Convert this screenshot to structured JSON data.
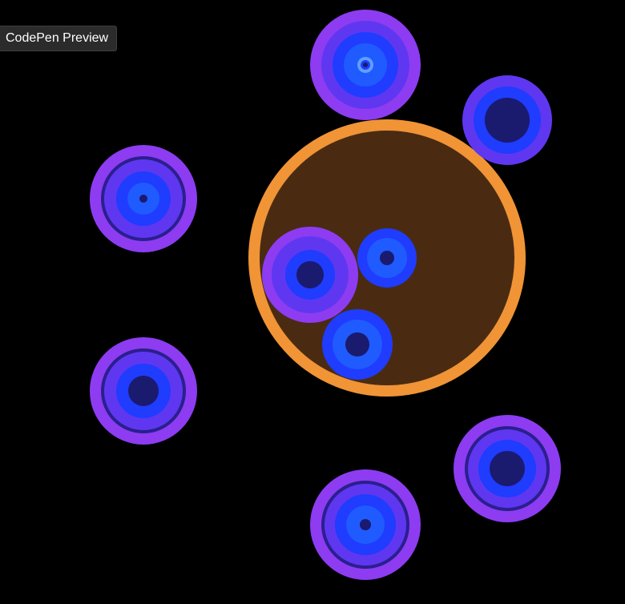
{
  "preview": {
    "label": "CodePen Preview"
  },
  "colors": {
    "background": "#000000",
    "container_fill": "#4a2b12",
    "container_stroke": "#f09436",
    "violet": "#8d3cf2",
    "indigo": "#5f37f0",
    "blue": "#1f3cff",
    "bright_blue": "#1f5bff",
    "navy": "#1a1a6e"
  },
  "icons": {
    "orbiting_circles": "concentric-circle-icon"
  }
}
